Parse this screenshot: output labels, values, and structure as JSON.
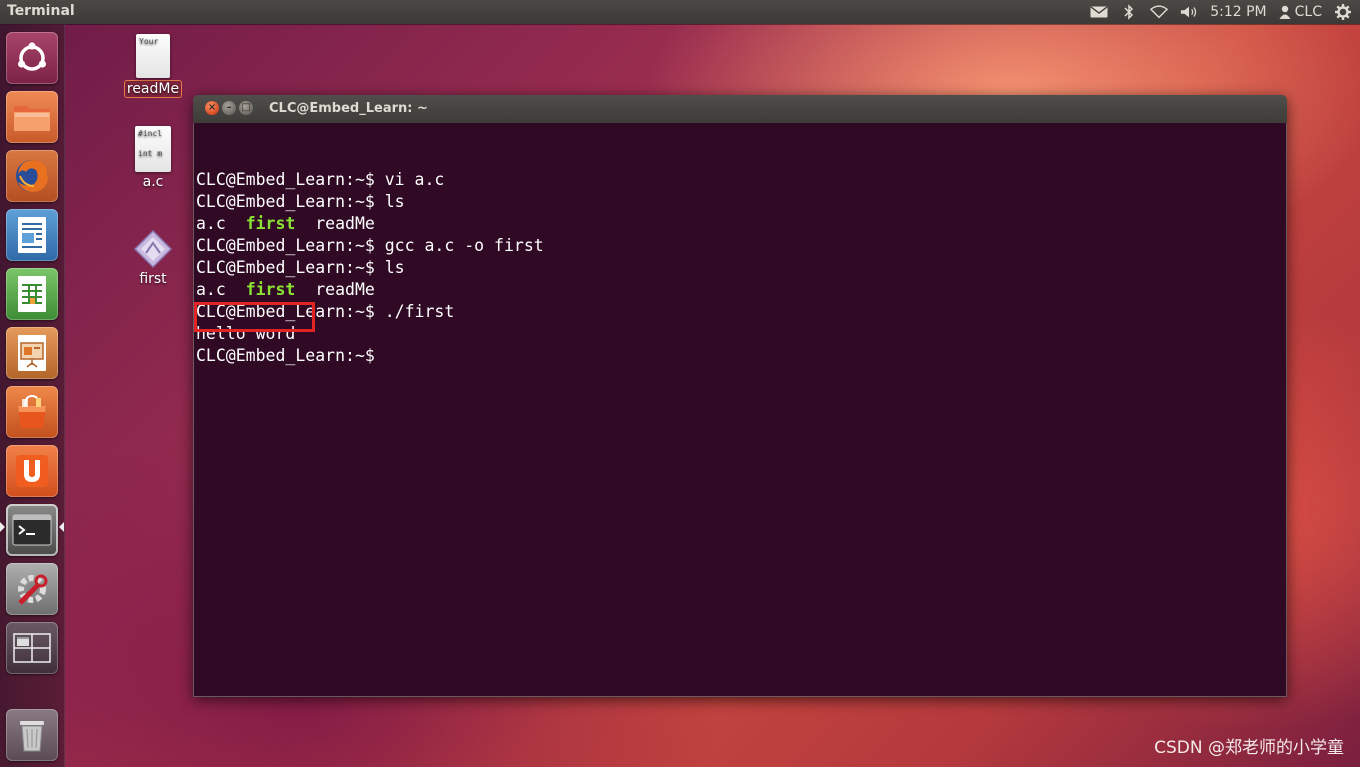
{
  "top_panel": {
    "app_title": "Terminal",
    "clock": "5:12 PM",
    "user": "CLC"
  },
  "launcher": {
    "items": [
      {
        "name": "dash-home",
        "icon": "ubuntu-logo-icon"
      },
      {
        "name": "files",
        "icon": "folder-icon"
      },
      {
        "name": "firefox",
        "icon": "firefox-icon"
      },
      {
        "name": "libreoffice-writer",
        "icon": "writer-icon"
      },
      {
        "name": "libreoffice-calc",
        "icon": "calc-icon"
      },
      {
        "name": "libreoffice-impress",
        "icon": "impress-icon"
      },
      {
        "name": "software-center",
        "icon": "shopping-bag-icon"
      },
      {
        "name": "ubuntu-one",
        "icon": "ubuntu-one-icon"
      },
      {
        "name": "terminal",
        "icon": "terminal-icon"
      },
      {
        "name": "system-settings",
        "icon": "settings-icon"
      },
      {
        "name": "workspace-switcher",
        "icon": "workspaces-icon"
      },
      {
        "name": "trash",
        "icon": "trash-icon"
      }
    ]
  },
  "desktop": {
    "icons": [
      {
        "label": "readMe",
        "thumb": "Your"
      },
      {
        "label": "a.c",
        "thumb_line1": "#incl",
        "thumb_line2": "int m"
      },
      {
        "label": "first"
      }
    ]
  },
  "terminal": {
    "window_title": "CLC@Embed_Learn: ~",
    "prompt": "CLC@Embed_Learn:~$ ",
    "lines": [
      {
        "type": "cmd",
        "text": "vi a.c"
      },
      {
        "type": "cmd",
        "text": "ls"
      },
      {
        "type": "ls",
        "a": "a.c",
        "b": "first",
        "c": "readMe"
      },
      {
        "type": "cmd",
        "text": "gcc a.c -o first"
      },
      {
        "type": "cmd",
        "text": "ls"
      },
      {
        "type": "ls",
        "a": "a.c",
        "b": "first",
        "c": "readMe"
      },
      {
        "type": "cmd",
        "text": "./first"
      },
      {
        "type": "out",
        "text": "hello word"
      },
      {
        "type": "cmd",
        "text": ""
      }
    ]
  },
  "watermark": "CSDN @郑老师的小学童",
  "colors": {
    "terminal_bg": "#300a24",
    "executable_green": "#8ae234",
    "highlight_red": "#e22424"
  }
}
